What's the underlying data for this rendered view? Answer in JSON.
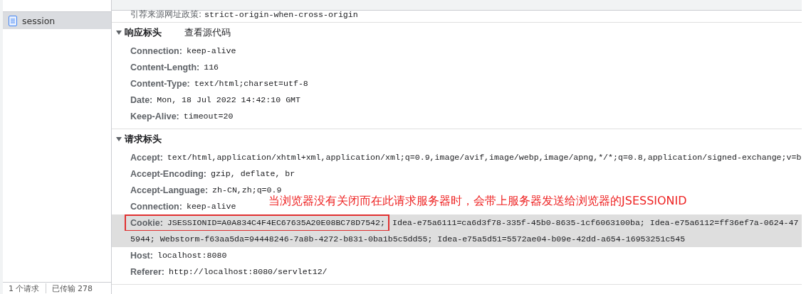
{
  "sidebar": {
    "items": [
      {
        "name": "session",
        "selected": true
      }
    ]
  },
  "status_bar": [
    "1 个请求",
    "已传输 278"
  ],
  "general_tail": {
    "key": "引荐来源网址政策:",
    "value": "strict-origin-when-cross-origin"
  },
  "sections": [
    {
      "title": "响应标头",
      "expanded": true,
      "view_source": "查看源代码",
      "headers": [
        {
          "key": "Connection:",
          "value": "keep-alive"
        },
        {
          "key": "Content-Length:",
          "value": "116"
        },
        {
          "key": "Content-Type:",
          "value": "text/html;charset=utf-8"
        },
        {
          "key": "Date:",
          "value": "Mon, 18 Jul 2022 14:42:10 GMT"
        },
        {
          "key": "Keep-Alive:",
          "value": "timeout=20"
        }
      ]
    },
    {
      "title": "请求标头",
      "expanded": true,
      "headers": [
        {
          "key": "Accept:",
          "value": "text/html,application/xhtml+xml,application/xml;q=0.9,image/avif,image/webp,image/apng,*/*;q=0.8,application/signed-exchange;v=b"
        },
        {
          "key": "Accept-Encoding:",
          "value": "gzip, deflate, br"
        },
        {
          "key": "Accept-Language:",
          "value": "zh-CN,zh;q=0.9"
        },
        {
          "key": "Connection:",
          "value": "keep-alive",
          "annotation": "当浏览器没有关闭而在此请求服务器时，会带上服务器发送给浏览器的JSESSIONID"
        },
        {
          "key": "Cookie:",
          "value": "JSESSIONID=A0A834C4F4EC67635A20E08BC78D7542;",
          "highlighted": true,
          "boxed": true,
          "continuation": [
            "Idea-e75a6111=ca6d3f78-335f-45b0-8635-1cf6063100ba; Idea-e75a6112=ff36ef7a-0624-47",
            "5944; Webstorm-f63aa5da=94448246-7a8b-4272-b831-0ba1b5c5dd55; Idea-e75a5d51=5572ae04-b09e-42dd-a654-16953251c545"
          ]
        },
        {
          "key": "Host:",
          "value": "localhost:8080"
        },
        {
          "key": "Referer:",
          "value": "http://localhost:8080/servlet12/"
        }
      ]
    }
  ]
}
